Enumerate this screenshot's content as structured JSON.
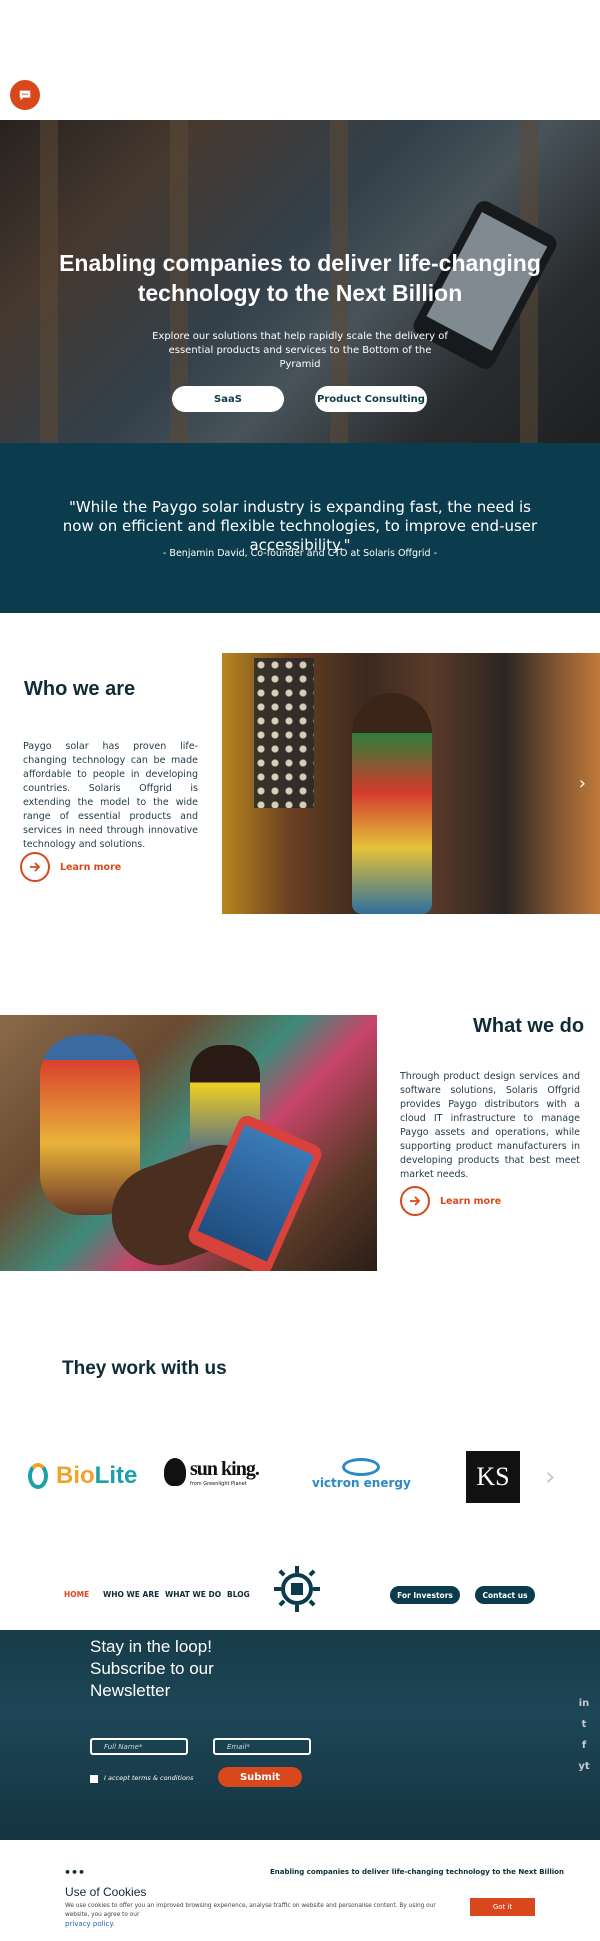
{
  "colors": {
    "accent": "#d9481c",
    "primary": "#0b3c4d",
    "link": "#1b67b5"
  },
  "chat": {
    "icon": "chat-bubble-icon"
  },
  "hero": {
    "title": "Enabling companies to deliver life-changing technology to the Next Billion",
    "subtitle": "Explore our solutions that help rapidly scale the delivery of essential products and services to the Bottom of the Pyramid",
    "buttons": [
      "SaaS",
      "Product Consulting"
    ]
  },
  "quote": {
    "text": "\"While the Paygo solar industry is expanding fast, the need is now on efficient and flexible technologies, to improve end-user accessibility.\"",
    "author": "- Benjamin David, Co-founder and CTO at Solaris Offgrid -"
  },
  "who": {
    "title": "Who we are",
    "body": "Paygo solar has proven life-changing technology can be made affordable to people in developing countries. Solaris Offgrid is extending the model to the wide range of essential products and services in need through innovative technology and solutions.",
    "link": "Learn more"
  },
  "what": {
    "title": "What we do",
    "body": "Through product design services and software solutions, Solaris Offgrid provides Paygo distributors with a cloud IT infrastructure to manage Paygo assets and operations, while supporting product manufacturers in developing products that best meet market needs.",
    "link": "Learn more"
  },
  "partners": {
    "title": "They work with us",
    "logos": {
      "biolite_a": "Bio",
      "biolite_b": "Lite",
      "sunking": "sun king.",
      "sunking_sub": "from Greenlight Planet",
      "victron": "victron energy",
      "krs": "KS"
    }
  },
  "nav": {
    "items": [
      "HOME",
      "WHO WE ARE",
      "WHAT WE DO",
      "BLOG"
    ],
    "investors": "For Investors",
    "contact": "Contact us"
  },
  "newsletter": {
    "title": "Stay in the loop! Subscribe to our Newsletter",
    "name_placeholder": "Full Name*",
    "email_placeholder": "Email*",
    "terms": "I accept terms & conditions",
    "submit": "Submit"
  },
  "social": [
    "in",
    "t",
    "f",
    "yt"
  ],
  "footer": {
    "tagline": "Enabling companies to deliver life-changing technology to the Next Billion"
  },
  "cookie": {
    "title": "Use of Cookies",
    "text": "We use cookies to offer you an improved browsing experience, analyse traffic on website and personalise content. By using our website, you agree to our",
    "policy": "privacy policy.",
    "button": "Got it"
  }
}
